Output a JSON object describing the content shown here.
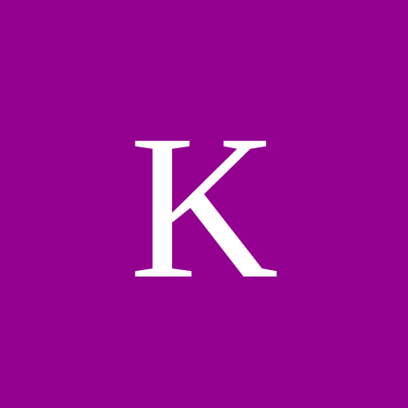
{
  "tile": {
    "letter": "K",
    "background_color": "#93008F",
    "letter_color": "#FFFFFF"
  }
}
